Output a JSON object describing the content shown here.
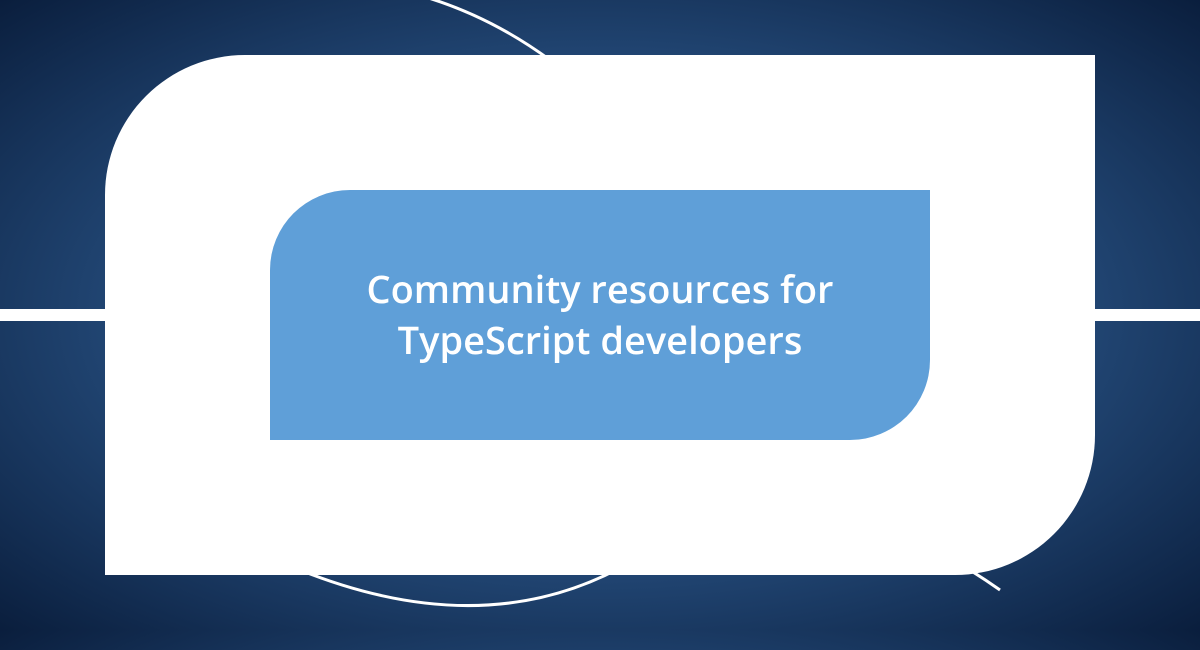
{
  "title": "Community resources for TypeScript developers",
  "colors": {
    "inner_bg": "#5f9fd8",
    "outer_bg": "#ffffff",
    "text": "#ffffff"
  }
}
